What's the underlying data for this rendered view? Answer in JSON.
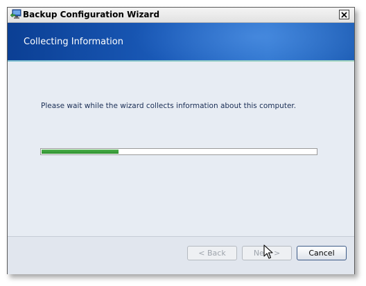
{
  "window": {
    "title": "Backup Configuration Wizard",
    "close_glyph": "×"
  },
  "banner": {
    "title": "Collecting Information"
  },
  "main": {
    "message": "Please wait while the wizard collects information about this computer.",
    "progress_fraction": 0.28
  },
  "buttons": {
    "back_label": "< Back",
    "next_label": "Next >",
    "cancel_label": "Cancel"
  },
  "icons": [
    "backup-wizard-app-icon",
    "close-icon",
    "mouse-pointer-icon"
  ],
  "colors": {
    "banner_blue": "#1a5ab8",
    "progress_green": "#2f8f2f"
  }
}
